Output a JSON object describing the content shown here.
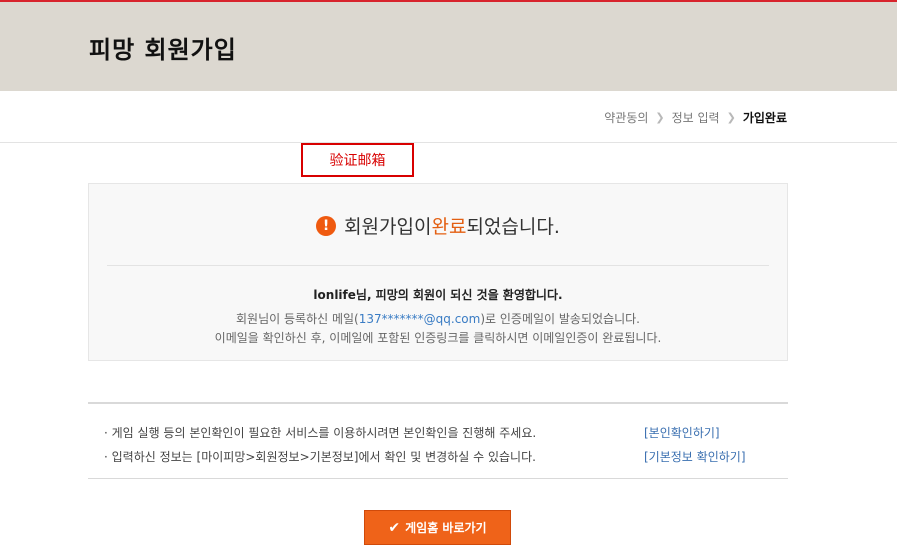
{
  "header": {
    "title": "피망 회원가입"
  },
  "steps": [
    {
      "label": "약관동의",
      "active": false
    },
    {
      "label": "정보 입력",
      "active": false
    },
    {
      "label": "가입완료",
      "active": true
    }
  ],
  "step_separator": "❯",
  "annotation": {
    "label": "验证邮箱"
  },
  "completion": {
    "icon": "exclamation-icon",
    "title_before": "회원가입이 ",
    "title_highlight": "완료",
    "title_after": "되었습니다.",
    "welcome": "lonlife님, 피망의 회원이 되신 것을 환영합니다.",
    "message1_before": "회원님이 등록하신 메일(",
    "email": "137*******@qq.com",
    "message1_after": ")로 인증메일이 발송되었습니다.",
    "message2": "이메일을 확인하신 후, 이메일에 포함된 인증링크를 클릭하시면 이메일인증이 완료됩니다."
  },
  "info": {
    "row1_text": "· 게임 실행 등의 본인확인이 필요한 서비스를 이용하시려면 본인확인을 진행해 주세요.",
    "row1_link": "[본인확인하기]",
    "row2_text": "· 입력하신 정보는 [마이피망>회원정보>기본정보]에서 확인 및 변경하실 수 있습니다.",
    "row2_link": "[기본정보 확인하기]"
  },
  "button": {
    "icon": "check-icon",
    "label": "게임홈 바로가기"
  },
  "colors": {
    "accent": "#ef6319",
    "header_bg": "#dcd8d0",
    "annotation": "#d80000",
    "link": "#3a6fb0"
  }
}
